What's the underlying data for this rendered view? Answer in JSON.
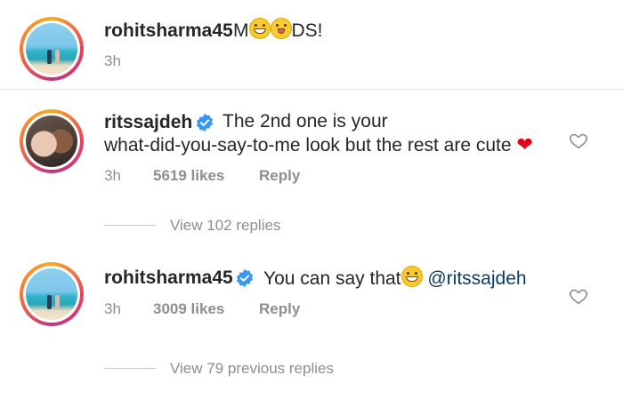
{
  "comment1": {
    "username": "rohitsharma45",
    "text_prefix": "M",
    "emoji_grin": "grinning-face-emoji",
    "emoji_tongue": "winking-tongue-emoji",
    "text_suffix": "DS!",
    "time": "3h"
  },
  "comment2": {
    "username": "ritssajdeh",
    "verified": "verified-badge-icon",
    "text_line1": "The 2nd one is your",
    "text_line2": "what-did-you-say-to-me look but the rest are cute",
    "heart_emoji": "❤",
    "time": "3h",
    "likes": "5619 likes",
    "reply": "Reply",
    "view_replies": "View 102 replies"
  },
  "comment3": {
    "username": "rohitsharma45",
    "verified": "verified-badge-icon",
    "text": "You can say that",
    "mention": "@ritssajdeh",
    "time": "3h",
    "likes": "3009 likes",
    "reply": "Reply",
    "view_replies": "View 79 previous replies"
  },
  "colors": {
    "text": "#262626",
    "muted": "#8e8e8e",
    "verified": "#3897f0",
    "heart": "#e0001b"
  }
}
